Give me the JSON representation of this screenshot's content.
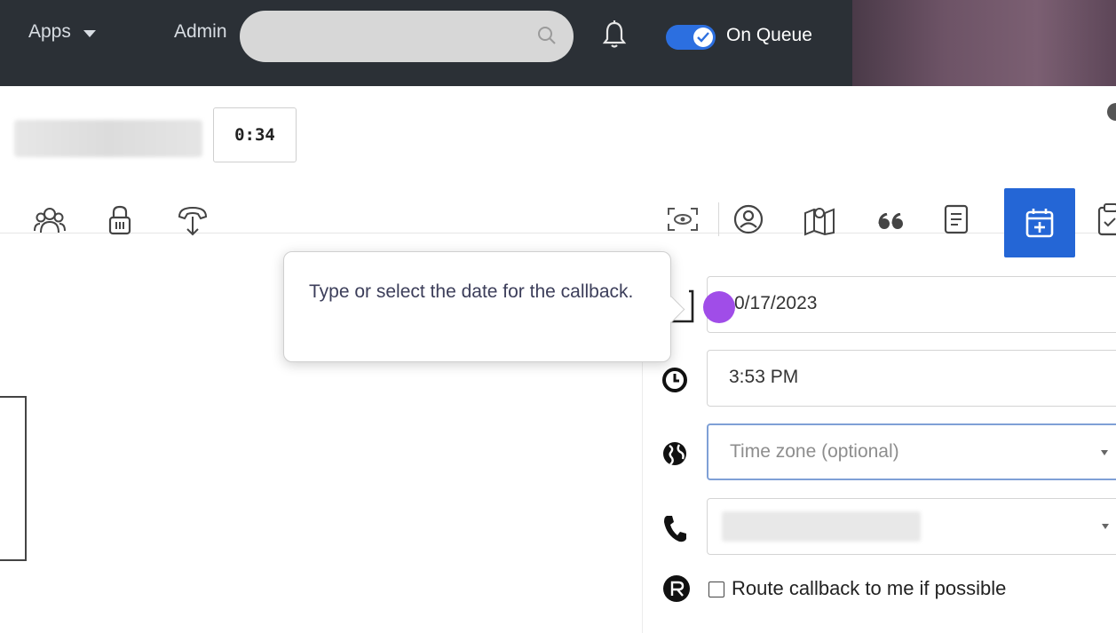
{
  "topbar": {
    "apps_label": "Apps",
    "admin_label": "Admin",
    "search_placeholder": "",
    "status_label": "On Queue",
    "status_on": true
  },
  "header": {
    "timer": "0:34"
  },
  "toolbar": {
    "left_icons": [
      "people-icon",
      "lock-icon",
      "transfer-icon"
    ],
    "right_icons": [
      "face-scan-icon",
      "contact-icon",
      "map-icon",
      "quote-icon",
      "notes-icon",
      "calendar-icon",
      "clipboard-icon"
    ],
    "active_tab": "calendar-icon",
    "accent_color": "#2466d6"
  },
  "tooltip": {
    "text": "Type or select the date for the callback."
  },
  "callback_form": {
    "date_value": "0/17/2023",
    "time_value": "3:53 PM",
    "timezone_placeholder": "Time zone (optional)",
    "route_label": "Route callback to me if possible",
    "route_checked": false
  }
}
